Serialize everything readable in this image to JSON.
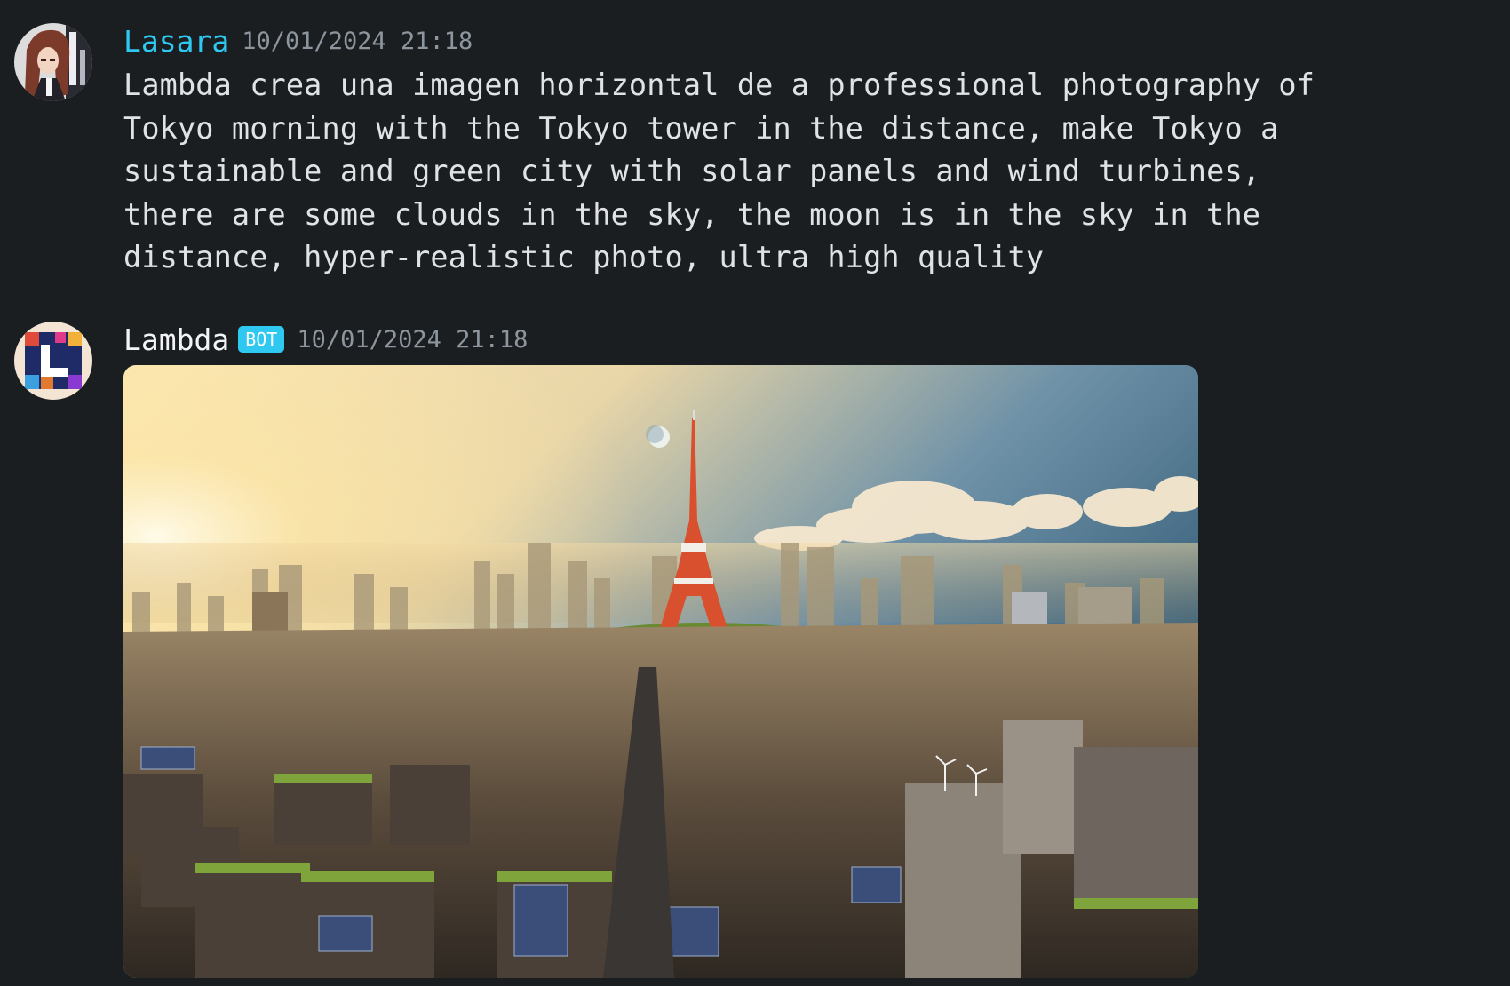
{
  "messages": [
    {
      "author": "Lasara",
      "timestamp": "10/01/2024 21:18",
      "text": "Lambda crea una imagen horizontal de a professional photography of\nTokyo morning with the Tokyo tower in the distance, make Tokyo a\nsustainable and green city with solar panels and wind turbines,\nthere are some clouds in the sky, the moon is in the sky in the\ndistance, hyper-realistic photo, ultra high quality"
    },
    {
      "author": "Lambda",
      "badge": "BOT",
      "timestamp": "10/01/2024 21:18",
      "attachment_icon": "generated-image"
    }
  ],
  "colors": {
    "background": "#1a1e20",
    "user_name": "#2ec8f0",
    "bot_badge": "#2ec8f0",
    "timestamp": "#8d959e"
  }
}
